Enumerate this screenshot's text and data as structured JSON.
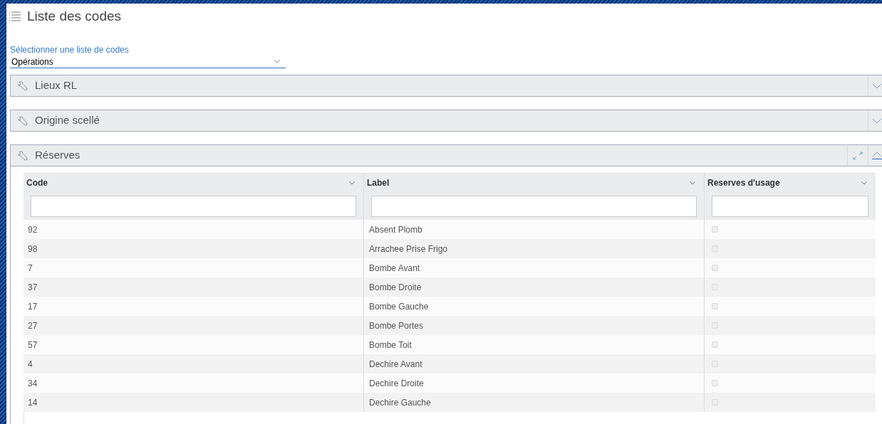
{
  "page": {
    "title": "Liste des codes"
  },
  "selector": {
    "label": "Sélectionner une liste de codes",
    "value": "Opérations"
  },
  "panels": [
    {
      "title": "Lieux RL",
      "expanded": false
    },
    {
      "title": "Origine scellé",
      "expanded": false
    },
    {
      "title": "Réserves",
      "expanded": true,
      "table": {
        "columns": [
          "Code",
          "Label",
          "Reserves d'usage"
        ],
        "rows": [
          {
            "code": "92",
            "label": "Absent Plomb",
            "checked": false
          },
          {
            "code": "98",
            "label": "Arrachee Prise Frigo",
            "checked": false
          },
          {
            "code": "7",
            "label": "Bombe Avant",
            "checked": false
          },
          {
            "code": "37",
            "label": "Bombe Droite",
            "checked": false
          },
          {
            "code": "17",
            "label": "Bombe Gauche",
            "checked": false
          },
          {
            "code": "27",
            "label": "Bombe Portes",
            "checked": false
          },
          {
            "code": "57",
            "label": "Bombe Toit",
            "checked": false
          },
          {
            "code": "4",
            "label": "Dechire Avant",
            "checked": false
          },
          {
            "code": "34",
            "label": "Dechire Droite",
            "checked": false
          },
          {
            "code": "14",
            "label": "Dechire Gauche",
            "checked": false
          }
        ]
      }
    }
  ]
}
